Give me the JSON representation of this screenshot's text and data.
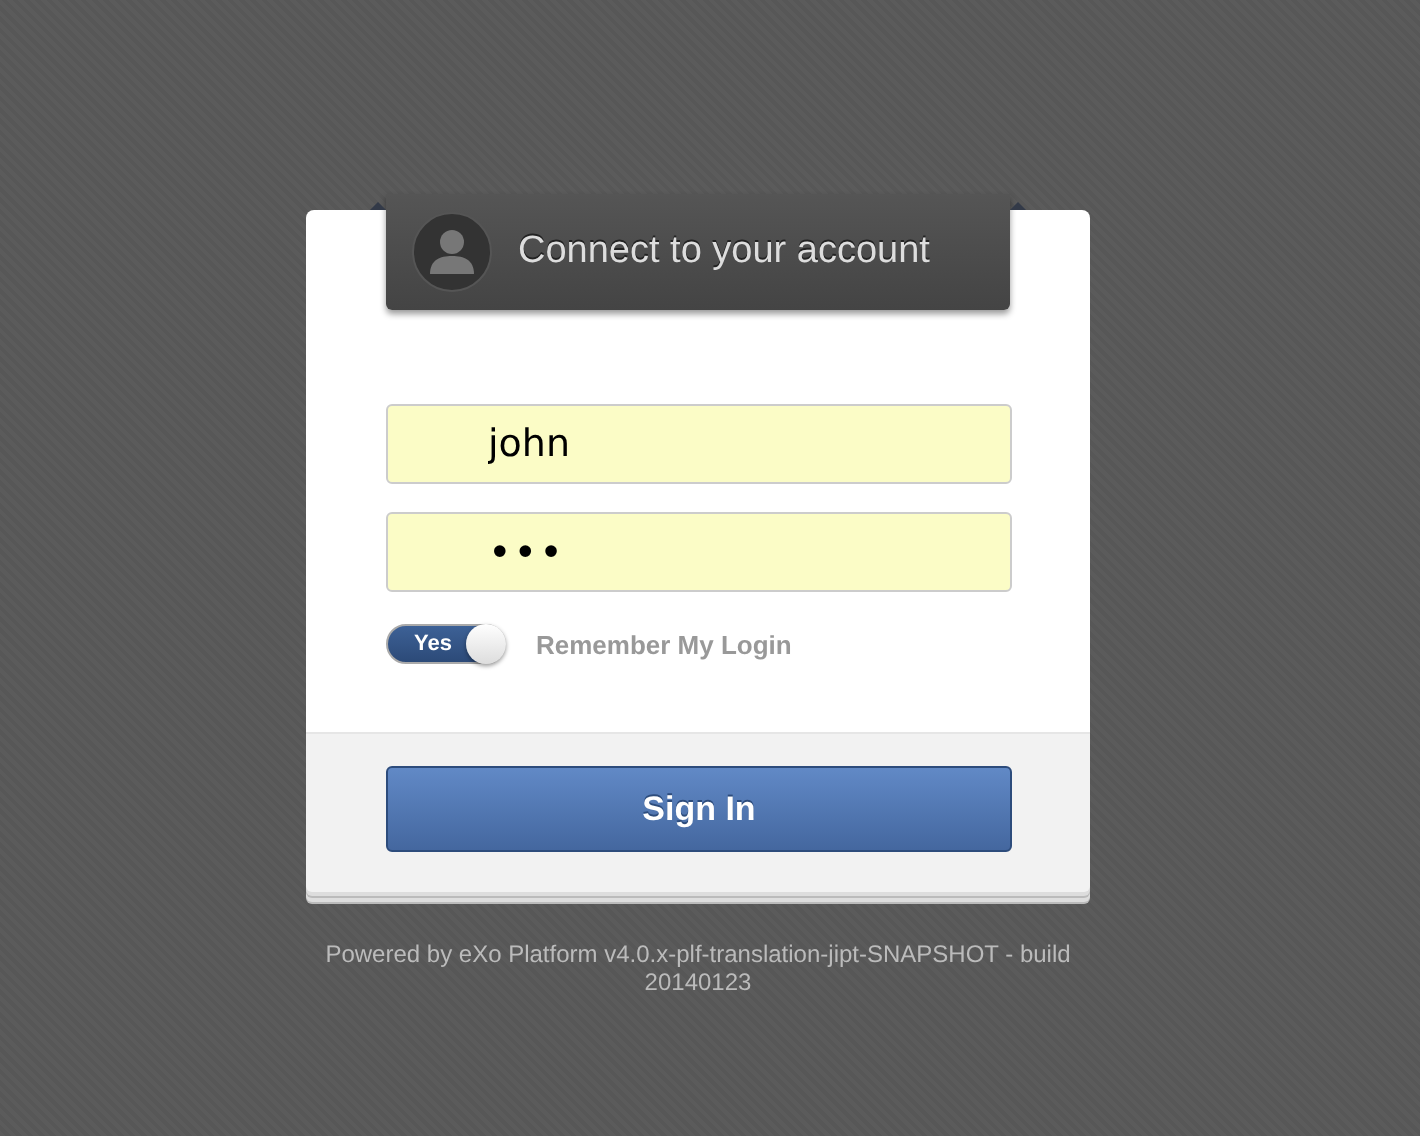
{
  "login": {
    "title": "Connect to your account",
    "username": {
      "value": "john"
    },
    "password": {
      "value": "•••"
    },
    "remember": {
      "label": "Remember My Login",
      "toggle_text": "Yes",
      "on": true
    },
    "sign_in": "Sign In"
  },
  "footer": "Powered by eXo Platform v4.0.x-plf-translation-jipt-SNAPSHOT - build 20140123"
}
